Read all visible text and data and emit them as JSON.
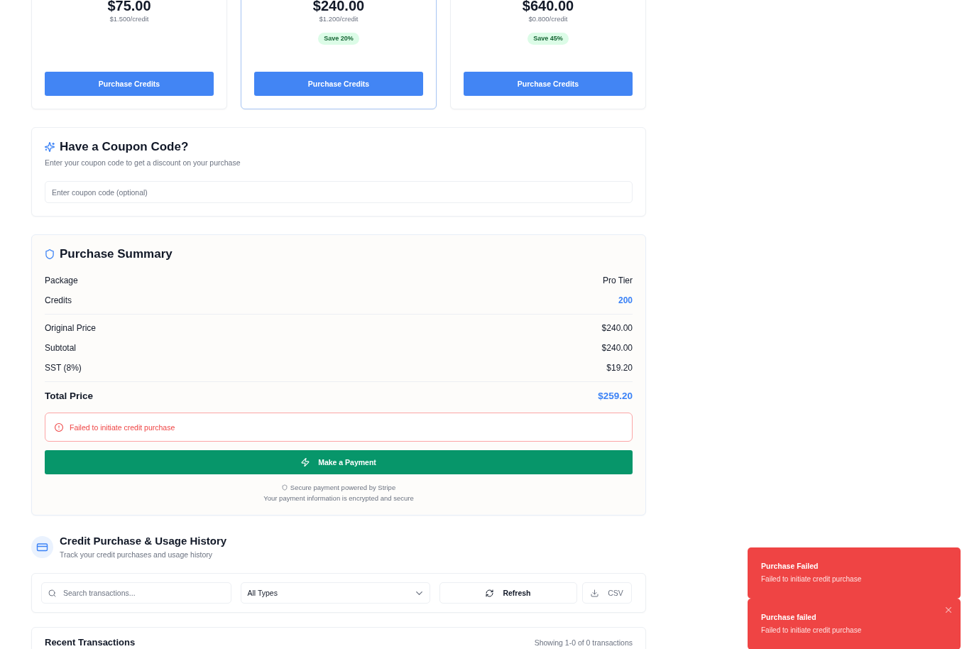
{
  "packages": [
    {
      "price": "$75.00",
      "per_credit": "$1.500/credit",
      "button": "Purchase Credits",
      "selected": false
    },
    {
      "price": "$240.00",
      "per_credit": "$1.200/credit",
      "badge": "Save 20%",
      "button": "Purchase Credits",
      "selected": true
    },
    {
      "price": "$640.00",
      "per_credit": "$0.800/credit",
      "badge": "Save 45%",
      "button": "Purchase Credits",
      "selected": false
    }
  ],
  "coupon": {
    "title": "Have a Coupon Code?",
    "subtitle": "Enter your coupon code to get a discount on your purchase",
    "placeholder": "Enter coupon code (optional)"
  },
  "summary": {
    "title": "Purchase Summary",
    "groups": [
      [
        {
          "label": "Package",
          "value": "Pro Tier",
          "highlight": false
        },
        {
          "label": "Credits",
          "value": "200",
          "highlight": true
        }
      ],
      [
        {
          "label": "Original Price",
          "value": "$240.00",
          "highlight": false
        },
        {
          "label": "Subtotal",
          "value": "$240.00",
          "highlight": false
        },
        {
          "label": "SST (8%)",
          "value": "$19.20",
          "highlight": false
        }
      ]
    ],
    "total": {
      "label": "Total Price",
      "value": "$259.20"
    },
    "error": "Failed to initiate credit purchase",
    "pay_button": "Make a Payment",
    "secure_note": "Secure payment powered by Stripe",
    "encryption_note": "Your payment information is encrypted and secure"
  },
  "history": {
    "title": "Credit Purchase & Usage History",
    "subtitle": "Track your credit purchases and usage history",
    "search_placeholder": "Search transactions...",
    "type_filter": "All Types",
    "buttons": [
      {
        "kind": "refresh",
        "label": "Refresh",
        "disabled": false
      },
      {
        "kind": "export",
        "label": "CSV",
        "disabled": true
      }
    ],
    "recent_title": "Recent Transactions",
    "count": "Showing 1-0 of 0 transactions"
  },
  "toasts": [
    {
      "title": "Purchase Failed",
      "message": "Failed to initiate credit purchase",
      "show_close": false
    },
    {
      "title": "Purchase failed",
      "message": "Failed to initiate credit purchase",
      "show_close": true
    }
  ]
}
